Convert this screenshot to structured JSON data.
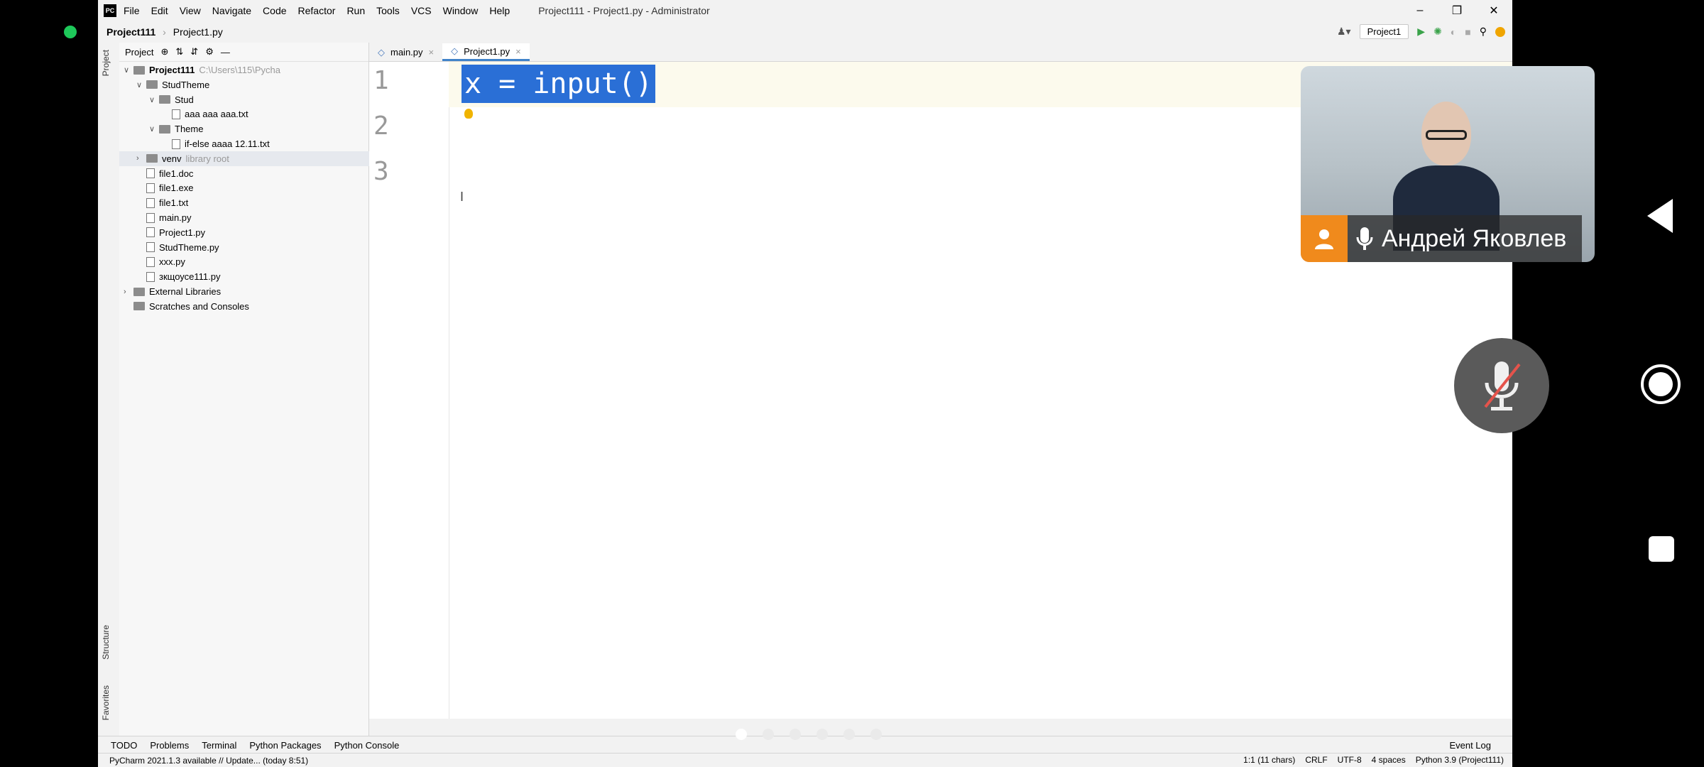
{
  "ide": {
    "logo": "PC",
    "menu": [
      "File",
      "Edit",
      "View",
      "Navigate",
      "Code",
      "Refactor",
      "Run",
      "Tools",
      "VCS",
      "Window",
      "Help"
    ],
    "window_title": "Project111 - Project1.py - Administrator",
    "breadcrumb": {
      "project": "Project111",
      "file": "Project1.py"
    },
    "run_config": "Project1",
    "panel_title": "Project",
    "tree": [
      {
        "label": "Project111",
        "extra": "C:\\Users\\115\\Pycha",
        "type": "folder",
        "arrow": "v",
        "indent": 0,
        "bold": true
      },
      {
        "label": "StudTheme",
        "type": "folder",
        "arrow": "v",
        "indent": 1
      },
      {
        "label": "Stud",
        "type": "folder",
        "arrow": "v",
        "indent": 2
      },
      {
        "label": "aaa aaa aaa.txt",
        "type": "file",
        "indent": 3
      },
      {
        "label": "Theme",
        "type": "folder",
        "arrow": "v",
        "indent": 2
      },
      {
        "label": "if-else aaaa 12.11.txt",
        "type": "file",
        "indent": 3
      },
      {
        "label": "venv",
        "extra": "library root",
        "type": "folder",
        "arrow": ">",
        "indent": 1,
        "highlight": true
      },
      {
        "label": "file1.doc",
        "type": "file",
        "indent": 1
      },
      {
        "label": "file1.exe",
        "type": "file",
        "indent": 1
      },
      {
        "label": "file1.txt",
        "type": "file",
        "indent": 1
      },
      {
        "label": "main.py",
        "type": "file",
        "indent": 1
      },
      {
        "label": "Project1.py",
        "type": "file",
        "indent": 1
      },
      {
        "label": "StudTheme.py",
        "type": "file",
        "indent": 1
      },
      {
        "label": "xxx.py",
        "type": "file",
        "indent": 1
      },
      {
        "label": "зкщоусе111.py",
        "type": "file",
        "indent": 1
      },
      {
        "label": "External Libraries",
        "type": "folder",
        "arrow": ">",
        "indent": 0
      },
      {
        "label": "Scratches and Consoles",
        "type": "folder",
        "indent": 0
      }
    ],
    "tabs": [
      "main.py",
      "Project1.py"
    ],
    "active_tab": "Project1.py",
    "line_numbers": [
      "1",
      "2",
      "3"
    ],
    "code_line": "x = input()",
    "side_labels": {
      "project": "Project",
      "structure": "Structure",
      "favorites": "Favorites"
    },
    "tool_windows": [
      "TODO",
      "Problems",
      "Terminal",
      "Python Packages",
      "Python Console"
    ],
    "event_log": "Event Log",
    "status_message": "PyCharm 2021.1.3 available // Update... (today 8:51)",
    "status_right": [
      "1:1 (11 chars)",
      "CRLF",
      "UTF-8",
      "4 spaces",
      "Python 3.9 (Project111)"
    ]
  },
  "call": {
    "participant_name": "Андрей Яковлев",
    "accent_color": "#f08a1c",
    "recording_indicator_color": "#1ec85a"
  }
}
